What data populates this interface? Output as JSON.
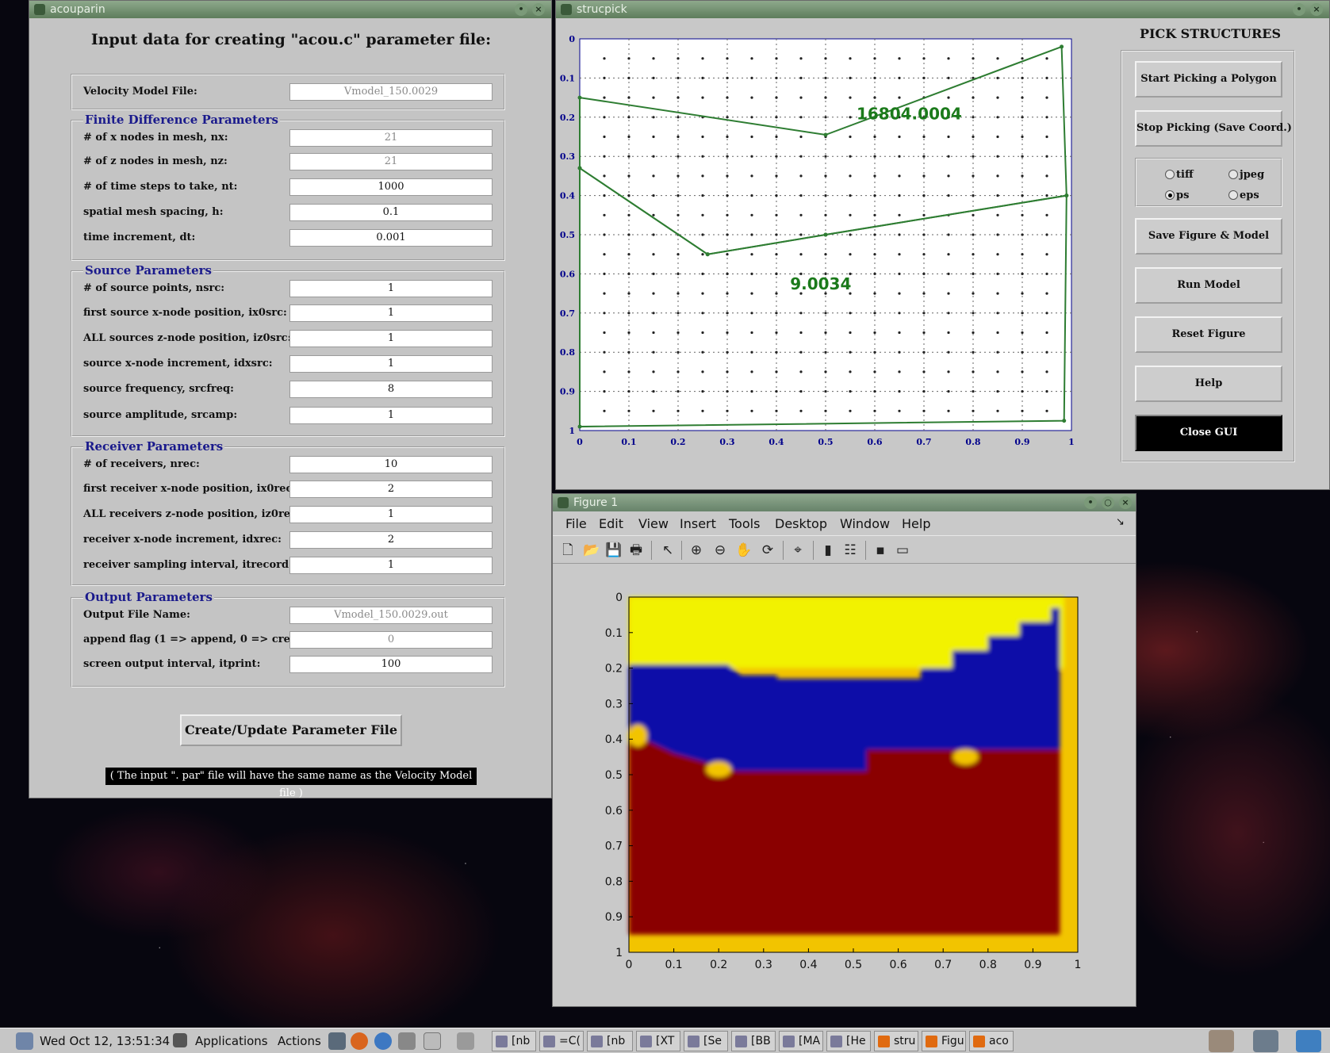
{
  "acouparin": {
    "title": "acouparin",
    "heading": "Input data for creating \"acou.c\" parameter file:",
    "velocity_model": {
      "label": "Velocity Model File:",
      "value": "Vmodel_150.0029"
    },
    "finite_difference": {
      "legend": "Finite Difference Parameters",
      "fields": [
        {
          "label": "# of x nodes in mesh, nx:",
          "value": "21"
        },
        {
          "label": "# of z nodes in mesh, nz:",
          "value": "21"
        },
        {
          "label": "# of time steps to take, nt:",
          "value": "1000"
        },
        {
          "label": "spatial mesh spacing, h:",
          "value": "0.1"
        },
        {
          "label": "time increment, dt:",
          "value": "0.001"
        }
      ]
    },
    "source": {
      "legend": "Source Parameters",
      "fields": [
        {
          "label": "# of source points, nsrc:",
          "value": "1"
        },
        {
          "label": "first source x-node position, ix0src:",
          "value": "1"
        },
        {
          "label": "ALL sources z-node position, iz0src:",
          "value": "1"
        },
        {
          "label": "source x-node increment, idxsrc:",
          "value": "1"
        },
        {
          "label": "source frequency, srcfreq:",
          "value": "8"
        },
        {
          "label": "source amplitude, srcamp:",
          "value": "1"
        }
      ]
    },
    "receiver": {
      "legend": "Receiver Parameters",
      "fields": [
        {
          "label": "# of receivers, nrec:",
          "value": "10"
        },
        {
          "label": "first receiver x-node position, ix0rec:",
          "value": "2"
        },
        {
          "label": "ALL receivers z-node position, iz0rec:",
          "value": "1"
        },
        {
          "label": "receiver x-node increment, idxrec:",
          "value": "2"
        },
        {
          "label": "receiver sampling interval, itrecord:",
          "value": "1"
        }
      ]
    },
    "output": {
      "legend": "Output Parameters",
      "fields": [
        {
          "label": "Output File Name:",
          "value": "Vmodel_150.0029.out"
        },
        {
          "label": "append flag (1 => append, 0 => create):",
          "value": "0"
        },
        {
          "label": "screen output interval, itprint:",
          "value": "100"
        }
      ]
    },
    "create_button": "Create/Update Parameter File",
    "note": "( The input \". par\" file will have the same name as the Velocity Model file )"
  },
  "strucpick": {
    "title": "strucpick",
    "pick_title": "PICK STRUCTURES",
    "buttons": {
      "start": "Start Picking a Polygon",
      "stop": "Stop Picking (Save Coord.)",
      "save": "Save Figure & Model",
      "run": "Run Model",
      "reset": "Reset Figure",
      "help": "Help",
      "close": "Close GUI"
    },
    "formats": {
      "tiff": "tiff",
      "jpeg": "jpeg",
      "ps": "ps",
      "eps": "eps",
      "selected": "ps"
    },
    "colors": {
      "polygon": "#2e7d32",
      "label": "#1b7a1b",
      "axis": "#00008b"
    }
  },
  "figure1": {
    "title": "Figure 1",
    "menu": [
      "File",
      "Edit",
      "View",
      "Insert",
      "Tools",
      "Desktop",
      "Window",
      "Help"
    ],
    "tools": [
      "new-file-icon",
      "open-folder-icon",
      "save-icon",
      "print-icon",
      "pointer-icon",
      "zoom-in-icon",
      "zoom-out-icon",
      "pan-hand-icon",
      "rotate-icon",
      "data-cursor-icon",
      "colorbar-icon",
      "legend-icon",
      "hide-tools-icon",
      "show-tools-icon"
    ],
    "colors": {
      "top": "#f2f200",
      "middle": "#0a0aa8",
      "bottom": "#8a0000",
      "edge": "#f2c400"
    }
  },
  "chart_data": [
    {
      "type": "scatter",
      "xlim": [
        0,
        1
      ],
      "ylim": [
        0,
        1
      ],
      "y_reversed": true,
      "x_ticks": [
        "0",
        "0.1",
        "0.2",
        "0.3",
        "0.4",
        "0.5",
        "0.6",
        "0.7",
        "0.8",
        "0.9",
        "1"
      ],
      "y_ticks": [
        "0",
        "0.1",
        "0.2",
        "0.3",
        "0.4",
        "0.5",
        "0.6",
        "0.7",
        "0.8",
        "0.9",
        "1"
      ],
      "grid": true,
      "annotations": [
        {
          "text": "16804.0004",
          "x": 0.67,
          "y": 0.205
        },
        {
          "text": "9.0034",
          "x": 0.49,
          "y": 0.64
        }
      ],
      "polygons": [
        [
          [
            0.0,
            0.15
          ],
          [
            0.5,
            0.245
          ],
          [
            0.98,
            0.02
          ],
          [
            0.99,
            0.4
          ],
          [
            0.5,
            0.5
          ],
          [
            0.26,
            0.55
          ],
          [
            0.0,
            0.33
          ]
        ],
        [
          [
            0.0,
            0.33
          ],
          [
            0.26,
            0.55
          ],
          [
            0.5,
            0.5
          ],
          [
            0.99,
            0.4
          ],
          [
            0.985,
            0.975
          ],
          [
            0.0,
            0.99
          ]
        ]
      ]
    },
    {
      "type": "heatmap",
      "xlim": [
        0,
        1
      ],
      "ylim": [
        0,
        1
      ],
      "y_reversed": true,
      "x_ticks": [
        "0",
        "0.1",
        "0.2",
        "0.3",
        "0.4",
        "0.5",
        "0.6",
        "0.7",
        "0.8",
        "0.9",
        "1"
      ],
      "y_ticks": [
        "0",
        "0.1",
        "0.2",
        "0.3",
        "0.4",
        "0.5",
        "0.6",
        "0.7",
        "0.8",
        "0.9",
        "1"
      ]
    }
  ],
  "taskbar": {
    "clock": "Wed Oct 12, 13:51:34",
    "applications": "Applications",
    "actions": "Actions",
    "tasks": [
      "[nb",
      "=C(",
      "[nb",
      "[XT",
      "[Se",
      "[BB",
      "[MA",
      "[He",
      "stru",
      "Figu",
      "aco"
    ]
  }
}
